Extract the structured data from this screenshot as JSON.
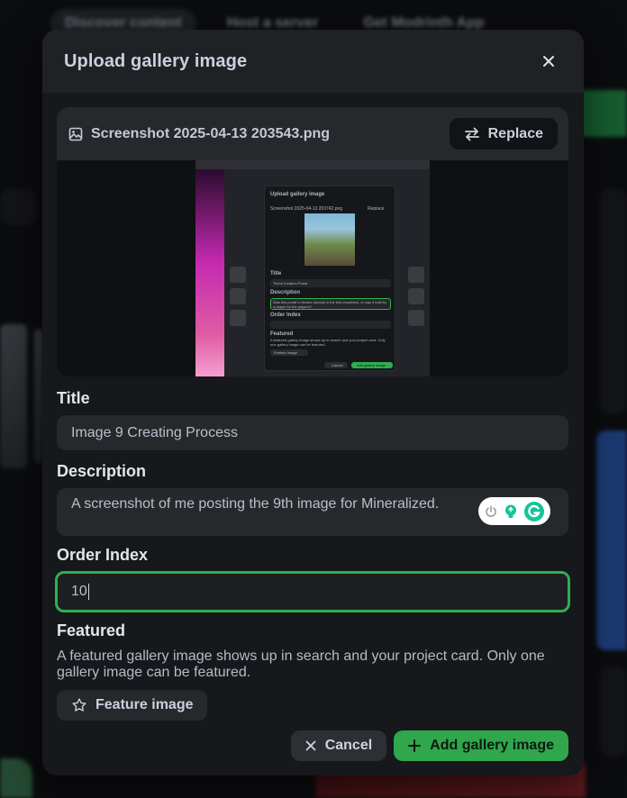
{
  "background": {
    "nav_discover": "Discover content",
    "nav_host": "Host a server",
    "nav_app": "Get Modrinth App"
  },
  "modal": {
    "title": "Upload gallery image",
    "file": {
      "name": "Screenshot 2025-04-13 203543.png",
      "replace_label": "Replace"
    },
    "fields": {
      "title_label": "Title",
      "title_value": "Image 9 Creating Process",
      "description_label": "Description",
      "description_value": "A screenshot of me posting the 9th image for Mineralized.",
      "order_label": "Order Index",
      "order_value": "10",
      "featured_label": "Featured",
      "featured_help": "A featured gallery image shows up in search and your project card. Only one gallery image can be featured.",
      "feature_button": "Feature image"
    },
    "footer": {
      "cancel_label": "Cancel",
      "add_label": "Add gallery image"
    }
  },
  "preview": {
    "dialog_title": "Upload gallery image",
    "file_name": "Screenshot 2025-04-13 203742.png",
    "replace": "Replace",
    "title_label": "Title",
    "title_value": "Tinfoil Creation Portal",
    "description_label": "Description",
    "description_value": "Was this portal to thoses already in the trial chambers, or was it built by a player for the players?",
    "order_label": "Order Index",
    "featured_label": "Featured",
    "featured_help": "A featured gallery image shows up in search and your project card. Only one gallery image can be featured.",
    "feature_button": "Feature image",
    "cancel": "Cancel",
    "add": "Add gallery image"
  },
  "colors": {
    "accent_green": "#30a64d",
    "focus_border": "#2fae52",
    "modal_bg": "#16181c"
  }
}
